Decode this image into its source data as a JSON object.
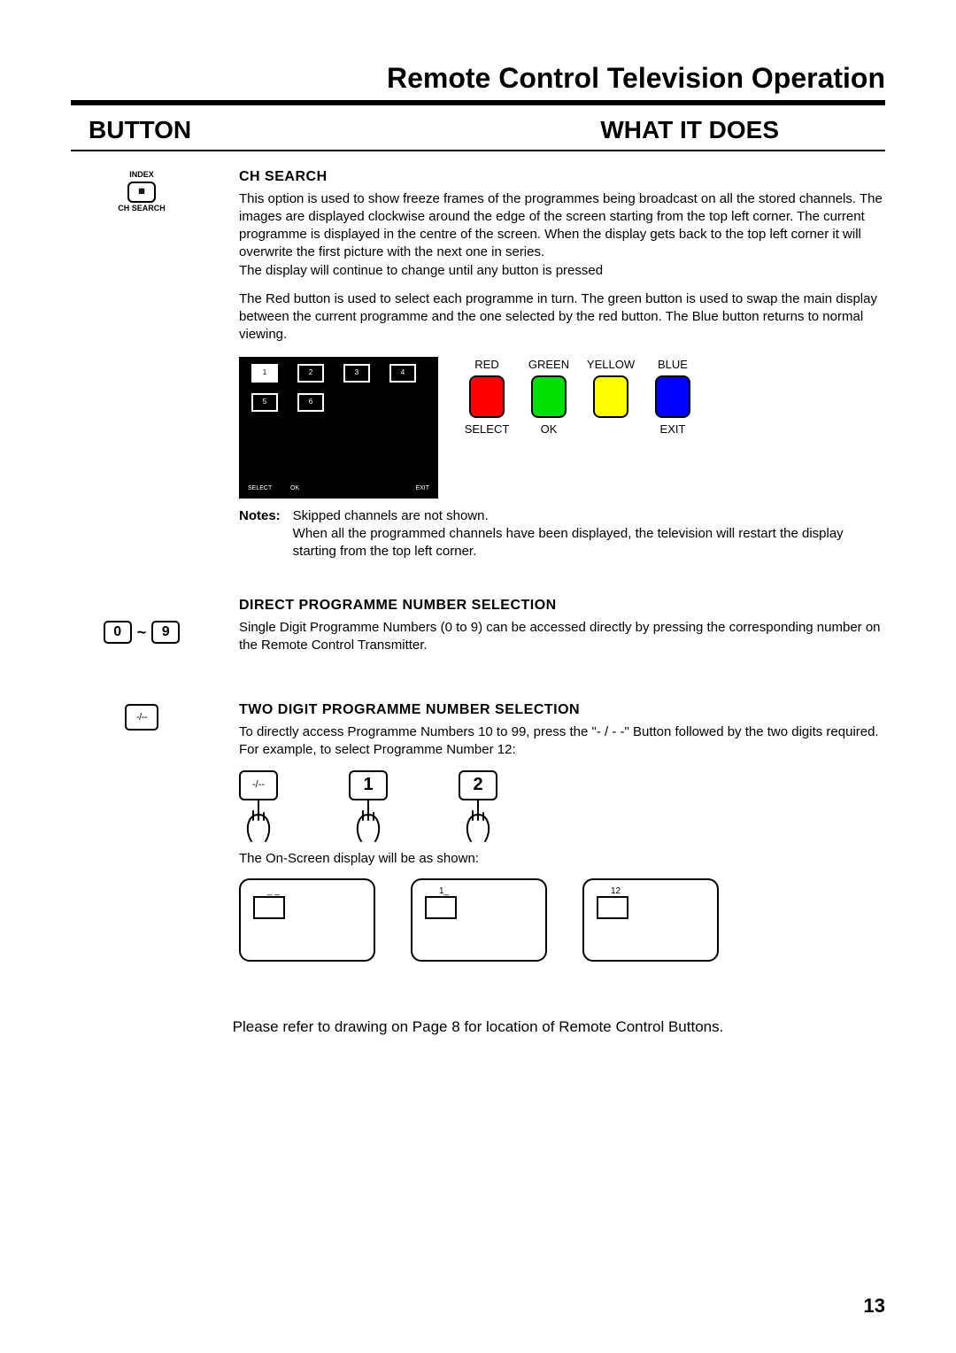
{
  "pageTitle": "Remote Control Television Operation",
  "header": {
    "left": "BUTTON",
    "right": "WHAT IT DOES"
  },
  "chSearch": {
    "iconTop": "INDEX",
    "iconBottom": "CH SEARCH",
    "heading": "CH SEARCH",
    "para1": "This option is used to show freeze frames of the programmes being broadcast on all the stored channels. The images are displayed clockwise around the edge of the screen starting from the top left corner. The current programme is displayed in the centre of the screen. When the display gets back to the top left corner it will overwrite the first picture with the next one in series.",
    "para1b": "The display will continue to change until any button is pressed",
    "para2": "The Red button is used to select each programme in turn. The green button is used to swap the main display between the current programme and the one selected by the red button. The Blue button returns to normal viewing.",
    "tvCells": [
      "1",
      "2",
      "3",
      "4",
      "5",
      "6"
    ],
    "tvFooter": {
      "select": "SELECT",
      "ok": "OK",
      "exit": "EXIT"
    },
    "colors": {
      "red": {
        "top": "RED",
        "bottom": "SELECT"
      },
      "green": {
        "top": "GREEN",
        "bottom": "OK"
      },
      "yellow": {
        "top": "YELLOW",
        "bottom": ""
      },
      "blue": {
        "top": "BLUE",
        "bottom": "EXIT"
      }
    },
    "notesLabel": "Notes:",
    "notes": "Skipped channels are not shown.\nWhen all the programmed channels have been displayed, the television will restart the display starting from the top left corner."
  },
  "direct": {
    "key0": "0",
    "tilde": "~",
    "key9": "9",
    "heading": "DIRECT PROGRAMME NUMBER SELECTION",
    "body": "Single Digit Programme Numbers (0 to 9) can be accessed directly by pressing the corresponding number on the Remote Control Transmitter."
  },
  "twoDigit": {
    "keyLabel": "-/--",
    "heading": "TWO DIGIT PROGRAMME NUMBER SELECTION",
    "body": "To directly access Programme Numbers 10 to 99, press the \"- / - -\" Button followed by the two digits required. For example, to select Programme Number 12:",
    "pressKeys": [
      "-/--",
      "1",
      "2"
    ],
    "osdCaption": "The On-Screen display will be as shown:",
    "osdLabels": [
      "_ _",
      "1_",
      "12"
    ]
  },
  "footerNote": "Please refer to drawing on Page 8 for location of Remote Control Buttons.",
  "pageNumber": "13"
}
